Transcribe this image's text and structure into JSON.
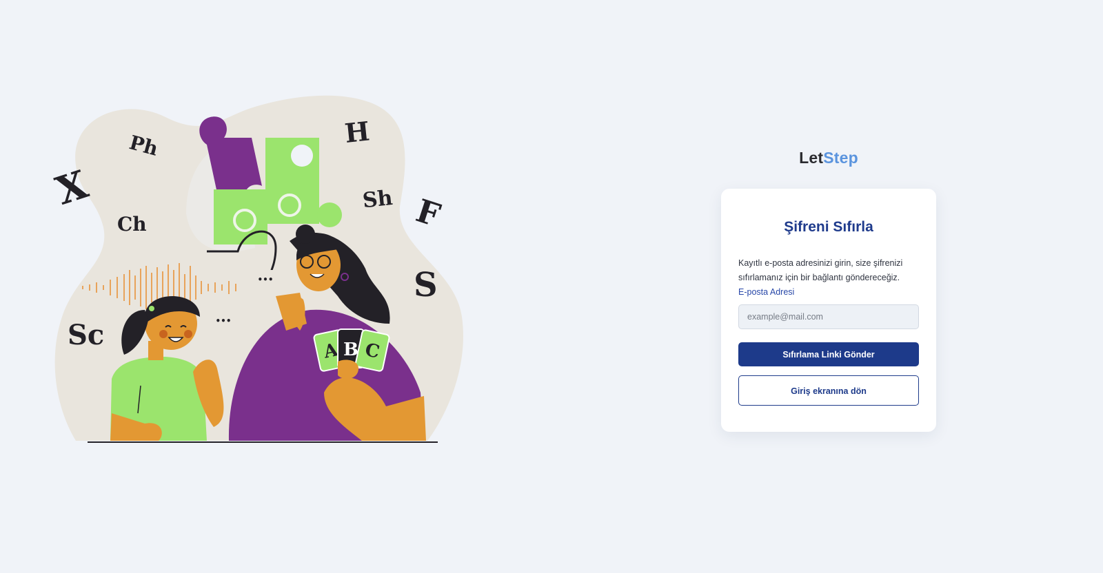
{
  "brand": {
    "part1": "Let",
    "part2": "Step"
  },
  "reset": {
    "title": "Şifreni Sıfırla",
    "description": "Kayıtlı e-posta adresinizi girin, size şifrenizi sıfırlamanız için bir bağlantı göndereceğiz.",
    "email_label": "E-posta Adresi",
    "email_placeholder": "example@mail.com",
    "email_value": "",
    "send_button": "Sıfırlama Linki Gönder",
    "back_button": "Giriş ekranına dön"
  },
  "illustration": {
    "letters": [
      "X",
      "Ph",
      "Ch",
      "H",
      "Sh",
      "F",
      "S",
      "Sc"
    ],
    "cards": [
      "A",
      "B",
      "C"
    ],
    "bubble_text": "•••",
    "colors": {
      "blob": "#e9e5dd",
      "puzzle_green": "#9be46d",
      "puzzle_purple": "#7a308c",
      "skin": "#e39833",
      "shirt_purple": "#7a308c",
      "shirt_green": "#9be46d",
      "hair": "#232127",
      "sound_wave": "#e8a35a"
    }
  },
  "colors": {
    "background": "#f0f3f8",
    "primary": "#1d3a8a",
    "brand_accent": "#5b94de",
    "label": "#2747a8"
  }
}
